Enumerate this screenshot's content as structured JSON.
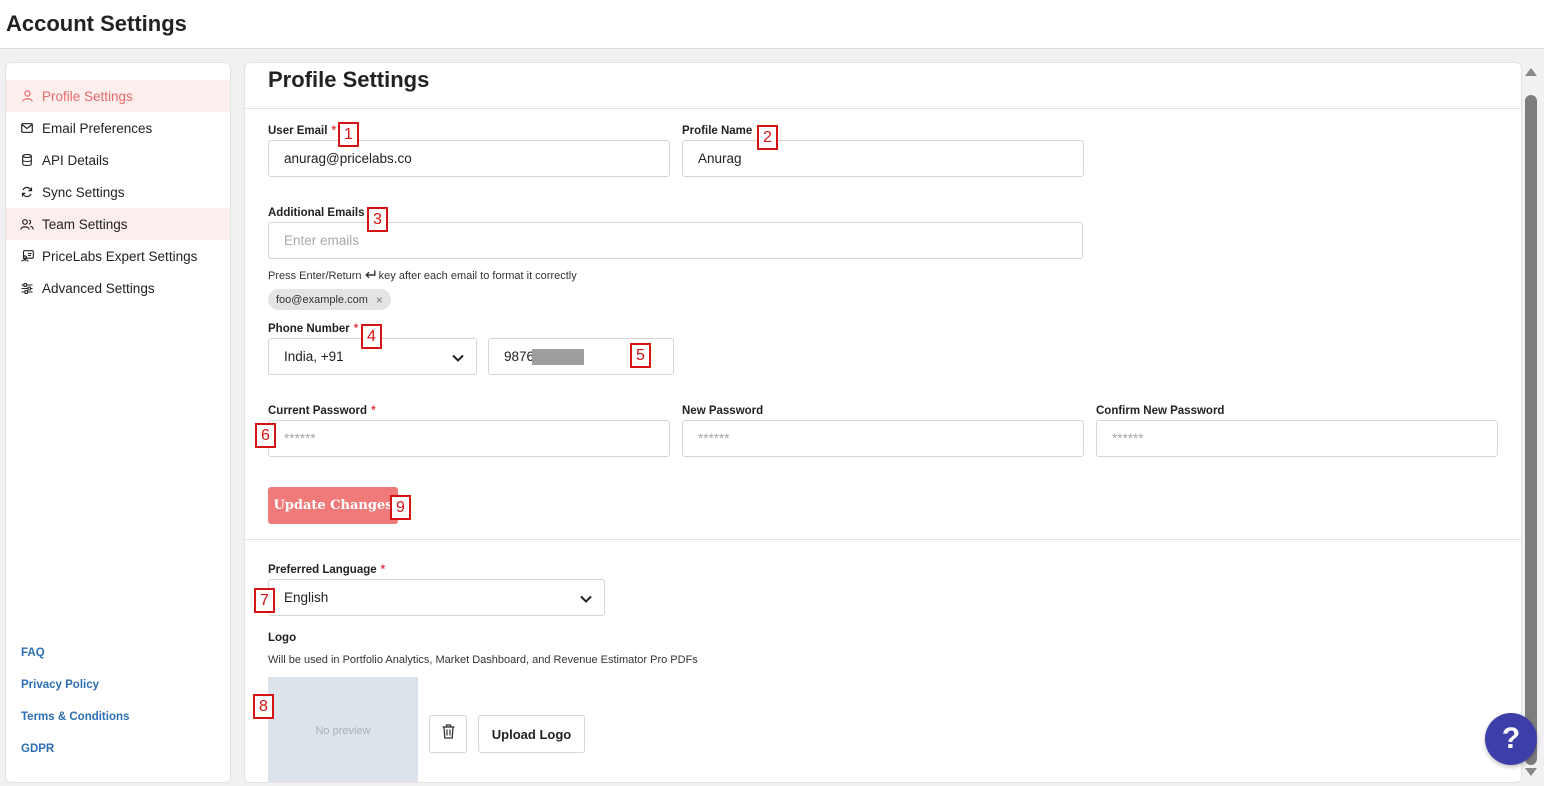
{
  "header": {
    "title": "Account Settings"
  },
  "sidebar": {
    "items": [
      {
        "label": "Profile Settings",
        "icon": "user-icon"
      },
      {
        "label": "Email Preferences",
        "icon": "mail-icon"
      },
      {
        "label": "API Details",
        "icon": "database-icon"
      },
      {
        "label": "Sync Settings",
        "icon": "sync-icon"
      },
      {
        "label": "Team Settings",
        "icon": "team-icon"
      },
      {
        "label": "PriceLabs Expert Settings",
        "icon": "expert-icon"
      },
      {
        "label": "Advanced Settings",
        "icon": "sliders-icon"
      }
    ],
    "active_item": "Profile Settings",
    "footer_links": [
      "FAQ",
      "Privacy Policy",
      "Terms & Conditions",
      "GDPR"
    ]
  },
  "main": {
    "title": "Profile Settings",
    "user_email": {
      "label": "User Email",
      "required": "*",
      "value": "anurag@pricelabs.co"
    },
    "profile_name": {
      "label": "Profile Name",
      "value": "Anurag"
    },
    "additional_emails": {
      "label": "Additional Emails",
      "placeholder": "Enter emails",
      "hint_before": "Press Enter/Return",
      "hint_after": "key after each email to format it correctly",
      "chip": "foo@example.com",
      "chip_remove": "×"
    },
    "phone": {
      "label": "Phone Number",
      "required": "*",
      "country": "India, +91",
      "number_visible": "9876"
    },
    "current_password": {
      "label": "Current Password",
      "required": "*",
      "placeholder": "******"
    },
    "new_password": {
      "label": "New Password",
      "placeholder": "******"
    },
    "confirm_password": {
      "label": "Confirm New Password",
      "placeholder": "******"
    },
    "update_button": "Update Changes",
    "language": {
      "label": "Preferred Language",
      "required": "*",
      "value": "English"
    },
    "logo": {
      "label": "Logo",
      "description": "Will be used in Portfolio Analytics, Market Dashboard, and Revenue Estimator Pro PDFs",
      "preview_text": "No preview",
      "upload_button": "Upload Logo"
    }
  },
  "annotations": [
    "1",
    "2",
    "3",
    "4",
    "5",
    "6",
    "7",
    "8",
    "9"
  ],
  "help_button": "?",
  "colors": {
    "accent": "#e86a6a",
    "button": "#f07a7a",
    "link": "#2d6fb3",
    "help": "#3e3ea8",
    "annotation": "#d41414"
  }
}
